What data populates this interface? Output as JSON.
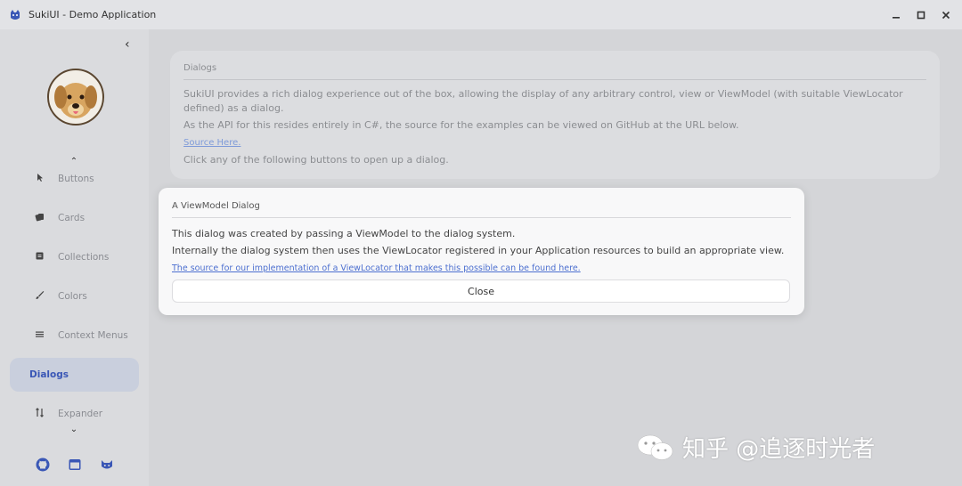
{
  "window": {
    "title": "SukiUI - Demo Application",
    "controls": [
      "minimize-icon",
      "maximize-icon",
      "close-icon"
    ]
  },
  "sidebar": {
    "items": [
      {
        "label": "Buttons",
        "icon": "pointer-icon"
      },
      {
        "label": "Cards",
        "icon": "cards-icon"
      },
      {
        "label": "Collections",
        "icon": "collection-icon"
      },
      {
        "label": "Colors",
        "icon": "brush-icon"
      },
      {
        "label": "Context Menus",
        "icon": "menu-icon"
      },
      {
        "label": "Dialogs",
        "icon": "",
        "active": true
      },
      {
        "label": "Expander",
        "icon": "expand-icon"
      }
    ],
    "bottom_icons": [
      "github-icon",
      "browser-icon",
      "cat-icon"
    ]
  },
  "card": {
    "title": "Dialogs",
    "line1": "SukiUI provides a rich dialog experience out of the box, allowing the display of any arbitrary control, view or ViewModel (with suitable ViewLocator defined) as a dialog.",
    "line2": "As the API for this resides entirely in C#, the source for the examples can be viewed on GitHub at the URL below.",
    "link": "Source Here.",
    "line3": "Click any of the following buttons to open up a dialog."
  },
  "dialog": {
    "title": "A ViewModel Dialog",
    "line1": "This dialog was created by passing a ViewModel to the dialog system.",
    "line2": "Internally the dialog system then uses the ViewLocator registered in your Application resources to build an appropriate view.",
    "link": "The source for our implementation of a ViewLocator that makes this possible can be found here.",
    "close_label": "Close"
  },
  "watermark": {
    "text": "知乎 @追逐时光者"
  },
  "colors": {
    "accent": "#3a57b6",
    "background": "#d4d5d8"
  }
}
